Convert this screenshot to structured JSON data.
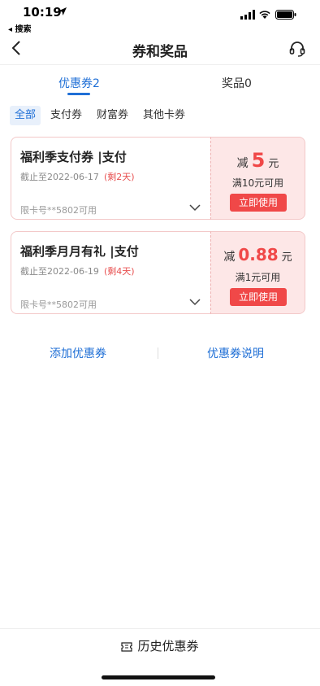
{
  "status_bar": {
    "time": "10:19",
    "back_app": "◂ 搜索"
  },
  "nav": {
    "title": "券和奖品"
  },
  "tabs": [
    {
      "label": "优惠券2",
      "active": true
    },
    {
      "label": "奖品0",
      "active": false
    }
  ],
  "filters": [
    {
      "label": "全部",
      "active": true
    },
    {
      "label": "支付券",
      "active": false
    },
    {
      "label": "财富券",
      "active": false
    },
    {
      "label": "其他卡券",
      "active": false
    }
  ],
  "coupons": [
    {
      "title": "福利季支付券 |支付",
      "expiry": "截止至2022-06-17",
      "remaining": "(剩2天)",
      "card_limit": "限卡号**5802可用",
      "prefix": "减",
      "amount": "5",
      "unit": "元",
      "condition": "满10元可用",
      "button": "立即使用"
    },
    {
      "title": "福利季月月有礼 |支付",
      "expiry": "截止至2022-06-19",
      "remaining": "(剩4天)",
      "card_limit": "限卡号**5802可用",
      "prefix": "减",
      "amount": "0.88",
      "unit": "元",
      "condition": "满1元可用",
      "button": "立即使用"
    }
  ],
  "links": {
    "add": "添加优惠券",
    "help": "优惠券说明"
  },
  "bottom": {
    "history": "历史优惠券"
  },
  "colors": {
    "accent": "#1f6fd6",
    "coupon_red": "#f04848",
    "coupon_bg": "#fde7e7"
  }
}
